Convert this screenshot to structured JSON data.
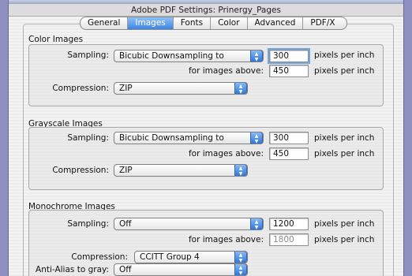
{
  "window": {
    "title": "Adobe PDF Settings: Prinergy_Pages"
  },
  "tabs": [
    {
      "label": "General"
    },
    {
      "label": "Images"
    },
    {
      "label": "Fonts"
    },
    {
      "label": "Color"
    },
    {
      "label": "Advanced"
    },
    {
      "label": "PDF/X"
    }
  ],
  "active_tab": "Images",
  "common": {
    "sampling_label": "Sampling:",
    "above_label": "for images above:",
    "compression_label": "Compression:",
    "ppi_label": "pixels per inch"
  },
  "color_images": {
    "title": "Color Images",
    "sampling": "Bicubic Downsampling to",
    "resolution": "300",
    "above": "450",
    "compression": "ZIP"
  },
  "grayscale_images": {
    "title": "Grayscale Images",
    "sampling": "Bicubic Downsampling to",
    "resolution": "300",
    "above": "450",
    "compression": "ZIP"
  },
  "monochrome_images": {
    "title": "Monochrome Images",
    "sampling": "Off",
    "resolution": "1200",
    "above": "1800",
    "compression": "CCITT Group 4",
    "antialias_label": "Anti-Alias to gray:",
    "antialias": "Off"
  },
  "icons": {
    "popup": "updown-arrows-icon"
  },
  "colors": {
    "accent": "#3d85e3",
    "desktop": "#8f90c2"
  }
}
